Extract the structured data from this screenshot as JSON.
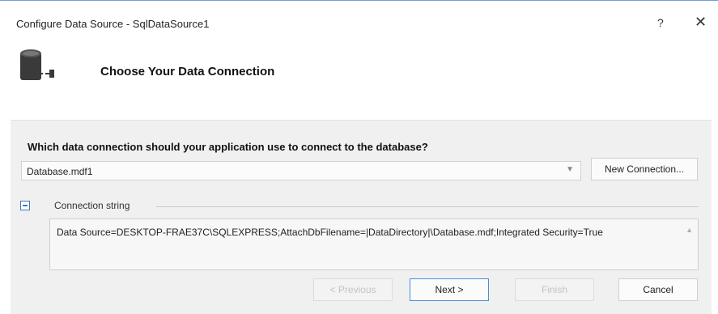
{
  "window": {
    "title": "Configure Data Source - SqlDataSource1",
    "help_glyph": "?",
    "close_glyph": "✕"
  },
  "header": {
    "heading": "Choose Your Data Connection",
    "icon": "database-icon"
  },
  "form": {
    "question": "Which data connection should your application use to connect to the database?",
    "selected_connection": "Database.mdf1",
    "new_connection_button": "New Connection...",
    "connection_string_label": "Connection string",
    "connection_string": "Data Source=DESKTOP-FRAE37C\\SQLEXPRESS;AttachDbFilename=|DataDirectory|\\Database.mdf;Integrated Security=True"
  },
  "footer": {
    "previous": "< Previous",
    "next": "Next >",
    "finish": "Finish",
    "cancel": "Cancel"
  },
  "colors": {
    "accent": "#3b78c2",
    "panel": "#f0f0f0"
  }
}
